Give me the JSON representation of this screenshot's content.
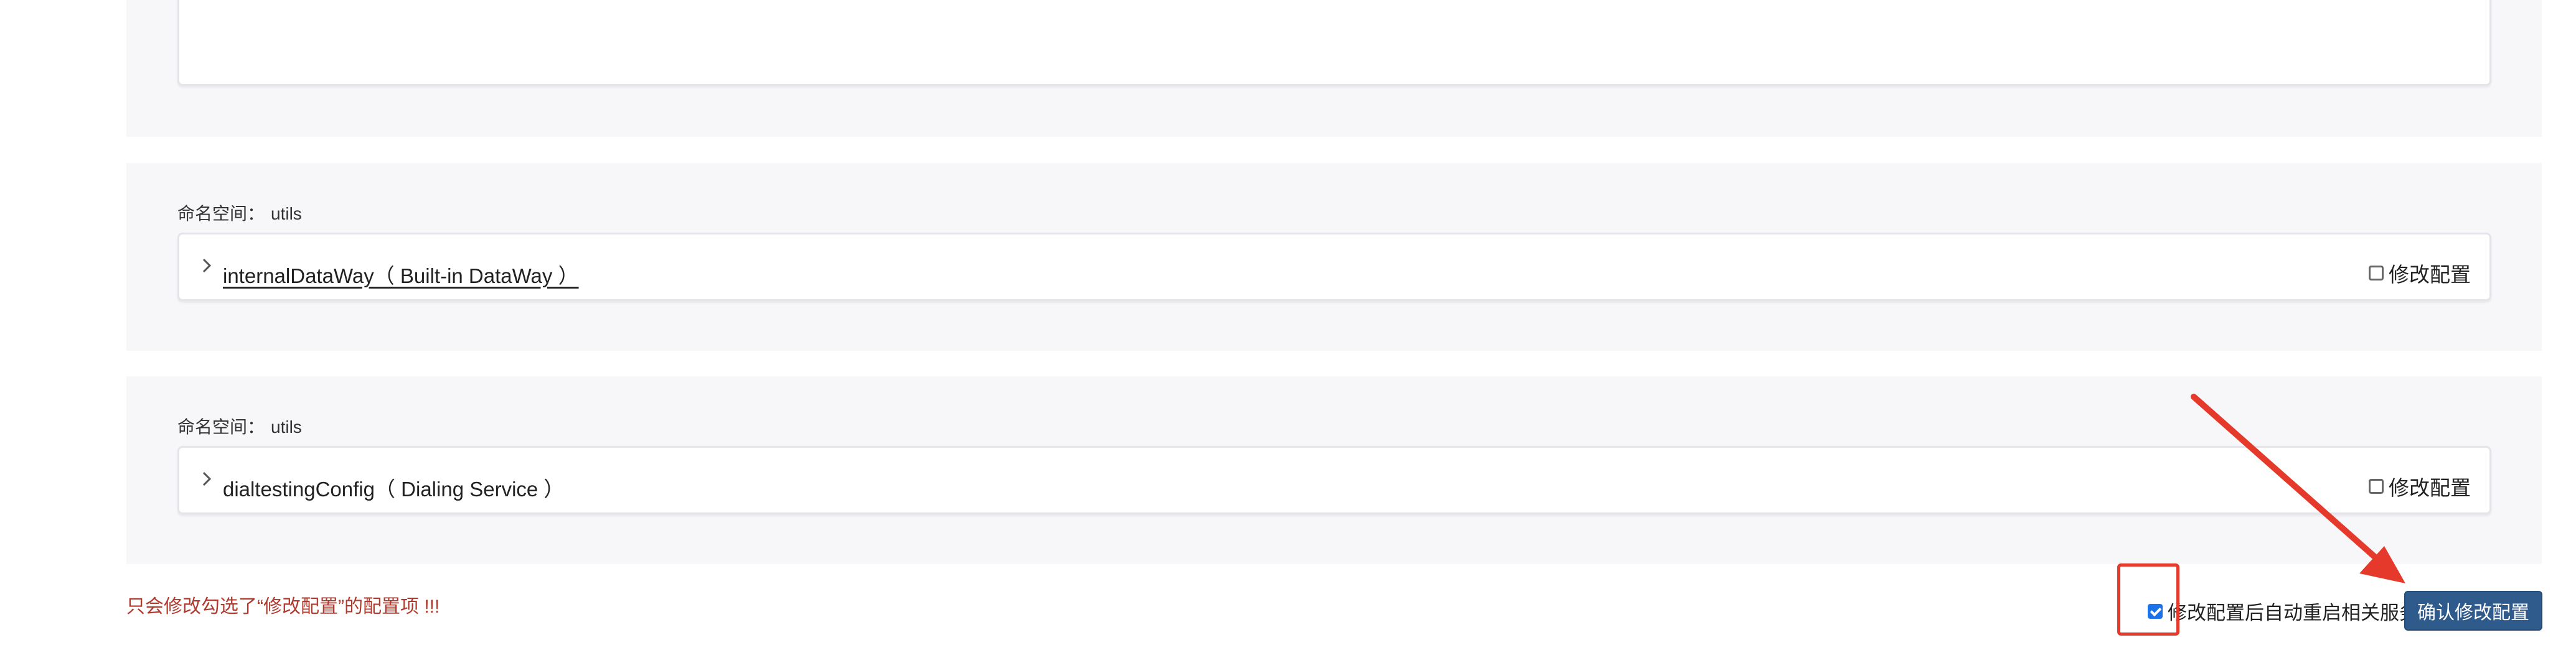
{
  "config_sections": [
    {
      "namespace_label": "命名空间：",
      "namespace_value": "utils",
      "item_name": "internalDataWay（ Built-in DataWay ）",
      "modify_label": "修改配置"
    },
    {
      "namespace_label": "命名空间：",
      "namespace_value": "utils",
      "item_name": "dialtestingConfig（ Dialing Service ）",
      "modify_label": "修改配置"
    }
  ],
  "footer": {
    "warning": "只会修改勾选了“修改配置”的配置项 !!!",
    "auto_restart_label": "修改配置后自动重启相关服务",
    "auto_restart_checked": true,
    "confirm_button": "确认修改配置"
  },
  "icons": {
    "expand": "chevron-right-icon",
    "annotation": "red-arrow-annotation"
  },
  "colors": {
    "warning_text": "#b03a2e",
    "button_bg": "#2f5a8c",
    "annotation_red": "#e53a2b",
    "section_bg": "#f7f7fa"
  }
}
